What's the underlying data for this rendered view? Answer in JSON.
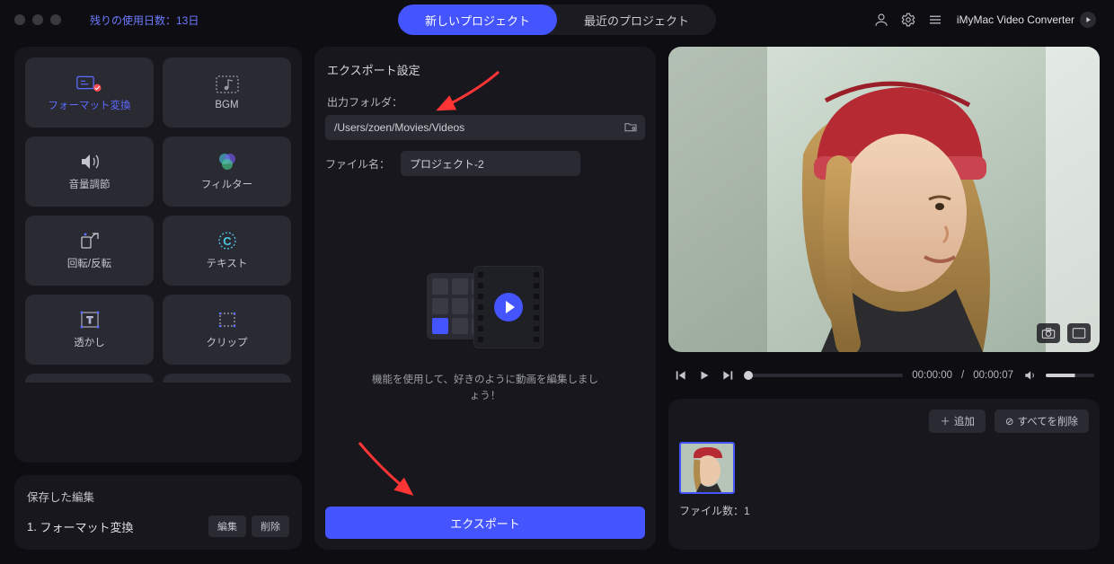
{
  "titlebar": {
    "remaining_days": "残りの使用日数：13日",
    "tab_new": "新しいプロジェクト",
    "tab_recent": "最近のプロジェクト",
    "brand": "iMyMac Video Converter"
  },
  "tools": {
    "format": "フォーマット変換",
    "bgm": "BGM",
    "volume": "音量調節",
    "filter": "フィルター",
    "rotate": "回転/反転",
    "text": "テキスト",
    "watermark": "透かし",
    "clip": "クリップ"
  },
  "saved": {
    "title": "保存した編集",
    "item_index": "1.",
    "item_label": "フォーマット変換",
    "edit_btn": "編集",
    "delete_btn": "削除"
  },
  "export": {
    "panel_title": "エクスポート設定",
    "folder_label": "出力フォルダ：",
    "folder_value": "/Users/zoen/Movies/Videos",
    "file_label": "ファイル名：",
    "file_value": "プロジェクト-2",
    "caption": "機能を使用して、好きのように動画を編集しましょう！",
    "export_btn": "エクスポート"
  },
  "player": {
    "time_current": "00:00:00",
    "time_total": "00:00:07"
  },
  "clips": {
    "add_btn": "追加",
    "delete_all_btn": "すべてを削除",
    "file_count_label": "ファイル数：",
    "file_count_value": "1"
  }
}
